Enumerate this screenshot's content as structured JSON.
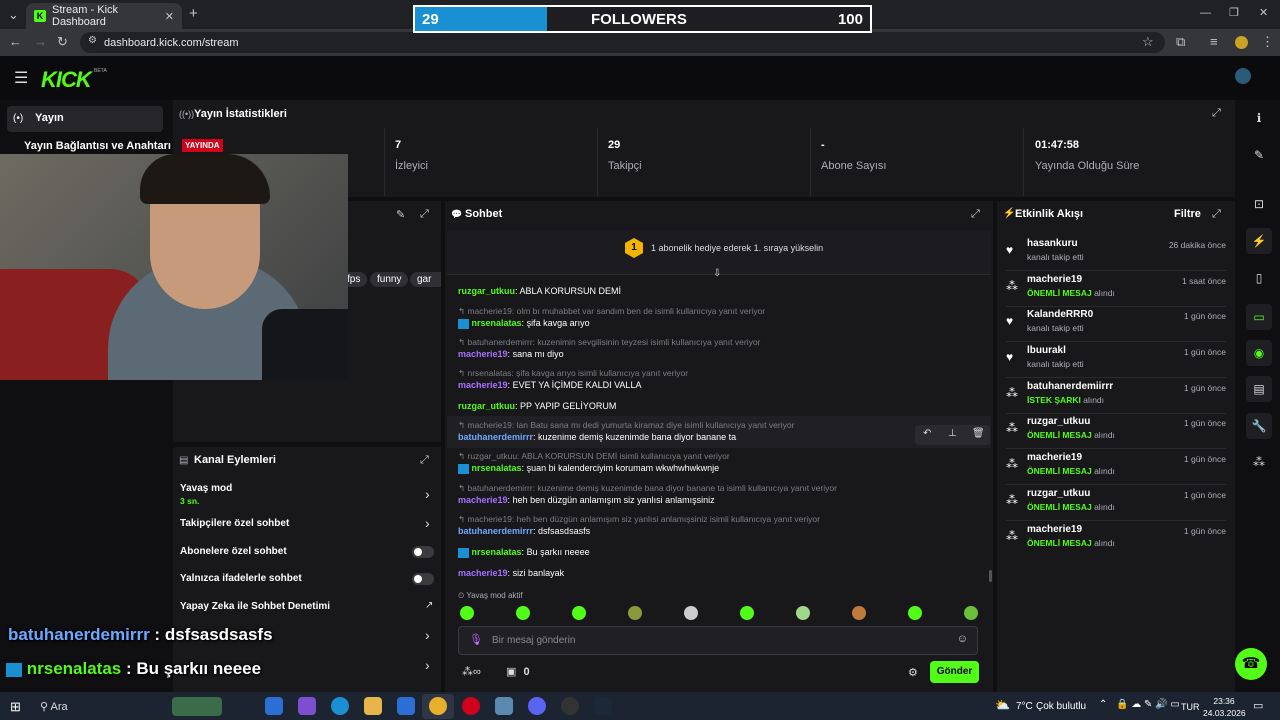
{
  "browser": {
    "tab_title": "Stream - Kick Dashboard",
    "url": "dashboard.kick.com/stream"
  },
  "overlay": {
    "followers_label": "FOLLOWERS",
    "followers_current": "29",
    "followers_goal": "100",
    "followers_progress": 0.29,
    "chat": [
      {
        "user": "batuhanerdemirrr",
        "sep": " : ",
        "text": "dsfsasdsasfs"
      },
      {
        "user": "nrsenalatas",
        "sep": " : ",
        "text": "Bu şarkıı neeee"
      }
    ]
  },
  "header": {
    "logo": "KICK",
    "logo_badge": "BETA"
  },
  "sidebar": {
    "items": [
      {
        "label": "Yayın"
      },
      {
        "label": "Yayın Bağlantısı ve Anahtarı"
      }
    ]
  },
  "stats": {
    "title": "Yayın İstatistikleri",
    "live_badge": "YAYINDA",
    "items": [
      {
        "value": "7",
        "label": "İzleyici"
      },
      {
        "value": "29",
        "label": "Takipçi"
      },
      {
        "value": "-",
        "label": "Abone Sayısı"
      },
      {
        "value": "01:47:58",
        "label": "Yayında Olduğu Süre"
      }
    ]
  },
  "stream_info": {
    "tags": [
      "fps",
      "funny",
      "gar"
    ]
  },
  "chat": {
    "title": "Sohbet",
    "pinned_rank": "1",
    "pinned_text": "1 abonelik hediye ederek 1. sıraya yükselin",
    "messages": [
      {
        "reply": "",
        "user": "ruzgar_utkuu",
        "text": "ABLA KORURSUN DEMİ"
      },
      {
        "reply": "macherie19: olm bı muhabbet var sandım ben de isimli kullanıcıya yanıt veriyor",
        "user": "nrsenalatas",
        "text": "şifa kavga arıyo"
      },
      {
        "reply": "batuhanerdemirrr: kuzenimin sevgilisinin teyzesi isimli kullanıcıya yanıt veriyor",
        "user": "macherie19",
        "text": "sana mı diyo"
      },
      {
        "reply": "nrsenalatas: şifa kavga arıyo isimli kullanıcıya yanıt veriyor",
        "user": "macherie19",
        "text": "EVET YA İÇİMDE KALDI VALLA"
      },
      {
        "reply": "",
        "user": "ruzgar_utkuu",
        "text": "PP YAPIP GELİYORUM"
      },
      {
        "reply": "macherie19: lan Batu sana mı dedi yumurta kiramaz diye isimli kullanıcıya yanıt veriyor",
        "user": "batuhanerdemirrr",
        "text": "kuzenime demiş kuzenimde bana diyor banane ta"
      },
      {
        "reply": "ruzgar_utkuu: ABLA KORURSUN DEMİ isimli kullanıcıya yanıt veriyor",
        "user": "nrsenalatas",
        "text": "şuan bi kalenderciyim korumam wkwhwhwkwnje"
      },
      {
        "reply": "batuhanerdemirrr: kuzenime demiş kuzenimde bana diyor banane ta isimli kullanıcıya yanıt veriyor",
        "user": "macherie19",
        "text": "heh ben düzgün anlamışım siz yanlısi anlamışsiniz"
      },
      {
        "reply": "macherie19: heh ben düzgün anlamışım siz yanlısi anlamışsiniz isimli kullanıcıya yanıt veriyor",
        "user": "batuhanerdemirrr",
        "text": "dsfsasdsasfs"
      },
      {
        "reply": "",
        "user": "nrsenalatas",
        "text": "Bu şarkıı neeee"
      },
      {
        "reply": "",
        "user": "macherie19",
        "text": "sizi banlayak"
      }
    ],
    "slow_mode_text": "Yavaş mod aktif",
    "input_placeholder": "Bir mesaj gönderin",
    "points": "∞",
    "chest_count": "0",
    "send_label": "Gönder"
  },
  "actions": {
    "title": "Kanal Eylemleri",
    "items": [
      {
        "label": "Yavaş mod",
        "sub": "3 sn."
      },
      {
        "label": "Takipçilere özel sohbet"
      },
      {
        "label": "Abonelere özel sohbet"
      },
      {
        "label": "Yalnızca ifadelerle sohbet"
      },
      {
        "label": "Yapay Zeka ile Sohbet Denetimi"
      }
    ]
  },
  "activity": {
    "title": "Etkinlik Akışı",
    "filter_label": "Filtre",
    "events": [
      {
        "user": "hasankuru",
        "sub": "kanalı takip etti",
        "highlight": "",
        "time": "26 dakika önce",
        "icon": "heart-icon"
      },
      {
        "user": "macherie19",
        "sub": "alındı",
        "highlight": "ÖNEMLİ MESAJ",
        "time": "1 saat önce",
        "icon": "kicks-icon"
      },
      {
        "user": "KalandeRRR0",
        "sub": "kanalı takip etti",
        "highlight": "",
        "time": "1 gün önce",
        "icon": "heart-icon"
      },
      {
        "user": "lbuurakl",
        "sub": "kanalı takip etti",
        "highlight": "",
        "time": "1 gün önce",
        "icon": "heart-icon"
      },
      {
        "user": "batuhanerdemiirrr",
        "sub": "alındı",
        "highlight": "İSTEK ŞARKI",
        "time": "1 gün önce",
        "icon": "kicks-icon"
      },
      {
        "user": "ruzgar_utkuu",
        "sub": "alındı",
        "highlight": "ÖNEMLİ MESAJ",
        "time": "1 gün önce",
        "icon": "kicks-icon"
      },
      {
        "user": "macherie19",
        "sub": "alındı",
        "highlight": "ÖNEMLİ MESAJ",
        "time": "1 gün önce",
        "icon": "kicks-icon"
      },
      {
        "user": "ruzgar_utkuu",
        "sub": "alındı",
        "highlight": "ÖNEMLİ MESAJ",
        "time": "1 gün önce",
        "icon": "kicks-icon"
      },
      {
        "user": "macherie19",
        "sub": "alındı",
        "highlight": "ÖNEMLİ MESAJ",
        "time": "1 gün önce",
        "icon": "kicks-icon"
      }
    ]
  },
  "taskbar": {
    "search_label": "Ara",
    "weather": "7°C",
    "weather_text": "Çok bulutlu",
    "lang": "TUR",
    "time": "23:36",
    "date": "24.03.2026"
  }
}
